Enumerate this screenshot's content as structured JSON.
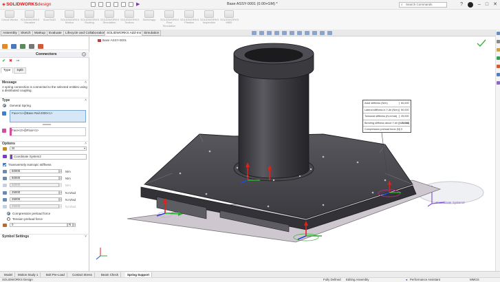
{
  "app": {
    "brand": "SOLIDWORKS",
    "product": "design",
    "document_title": "Base ASSY-0001 (0.00+GM) *",
    "search_placeholder": "Search Commands"
  },
  "ribbon": [
    "Circuit Works",
    "SOLIDWORKS Visualize",
    "ScanTo3D",
    "SOLIDWORKS Motion",
    "SOLIDWORKS Routing",
    "SOLIDWORKS Simulation",
    "SOLIDWORKS Toolbox",
    "Sketchapp",
    "SOLIDWORKS Flow Simulation",
    "SOLIDWORKS Plastics",
    "SOLIDWORKS Inspection",
    "SOLIDWORKS MBD"
  ],
  "command_tabs": [
    {
      "label": "Assembly"
    },
    {
      "label": "Sketch"
    },
    {
      "label": "Markup"
    },
    {
      "label": "Evaluate"
    },
    {
      "label": "Lifecycle and Collaboration"
    },
    {
      "label": "SOLIDWORKS Add-Ins",
      "active": true
    },
    {
      "label": "Simulation"
    }
  ],
  "panel": {
    "title": "Connectors",
    "help": "?",
    "type_tabs": [
      {
        "label": "Type",
        "active": true
      },
      {
        "label": "Split"
      }
    ],
    "message_header": "Message",
    "message": "A spring connection is connected to the selected entities using a distributed coupling.",
    "type_header": "Type",
    "general_spring": "General Spring",
    "selection_1": "Face<1>@Base Rail-2000<1>",
    "selection_2": "Face<2>@Floor<1>",
    "options_header": "Options",
    "unit_system": "SI",
    "coordinate_system": "Coordinate System2",
    "transversely_isotropic": "Transversely isotropic stiffness",
    "stiffness_fields": [
      {
        "value": "60000",
        "unit": "N/m",
        "disabled": false
      },
      {
        "value": "50000",
        "unit": "N/m",
        "disabled": false
      },
      {
        "value": "50000",
        "unit": "N/m",
        "disabled": true
      },
      {
        "value": "25000",
        "unit": "N.m/rad",
        "disabled": false
      },
      {
        "value": "25000",
        "unit": "N.m/rad",
        "disabled": false
      },
      {
        "value": "25000",
        "unit": "N.m/rad",
        "disabled": true
      }
    ],
    "compression_preload": "Compression preload force",
    "tension_preload": "Tension preload force",
    "preload_value": "0",
    "preload_unit": "N",
    "symbol_settings": "Symbol Settings"
  },
  "viewport": {
    "tree_label": "Base ASSY-0001",
    "coord_label": "Coordinate System2",
    "info_rows": [
      {
        "label": "Axial stiffness (N/m)",
        "value": "60,000"
      },
      {
        "label": "Lateral stiffness in Y-dir (N/m)",
        "value": "50,000"
      },
      {
        "label": "Torsional stiffness (N.m/rad)",
        "value": "25,000"
      },
      {
        "label": "Bending stiffness about Y-dir (N.m/rad)",
        "value": "25,000"
      },
      {
        "label": "Compression preload force (N)",
        "value": "0"
      }
    ]
  },
  "bottom_tabs": [
    {
      "label": "Model"
    },
    {
      "label": "Motion Study 1"
    },
    {
      "label": "Bolt Pre-Load"
    },
    {
      "label": "Contact Stress"
    },
    {
      "label": "Beam Check"
    },
    {
      "label": "Spring Support",
      "active": true
    }
  ],
  "status": {
    "left": "SOLIDWORKS Design",
    "defined": "Fully Defined",
    "mode": "Editing Assembly",
    "assistant": "Performance Assistant",
    "units": "MMGS"
  },
  "colors": {
    "brand_red": "#dd1111",
    "part_dark": "#3f3f44",
    "arrow_red": "#e0221b",
    "arrow_green": "#2bb02b",
    "arrow_blue": "#2448d6",
    "coord_purple": "#8a4ee0"
  }
}
